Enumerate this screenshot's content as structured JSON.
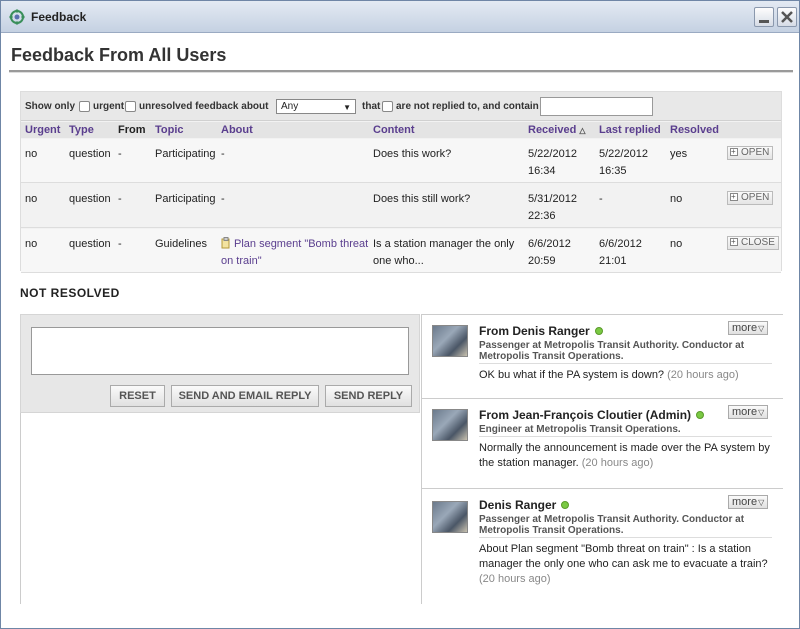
{
  "window": {
    "title": "Feedback"
  },
  "page": {
    "heading": "Feedback From All Users"
  },
  "filter": {
    "show_only": "Show only",
    "urgent": "urgent",
    "unresolved": "unresolved feedback about",
    "select_value": "Any",
    "that": "that",
    "not_replied": "are not replied to, and contain",
    "contain_value": ""
  },
  "table": {
    "headers": {
      "urgent": "Urgent",
      "type": "Type",
      "from": "From",
      "topic": "Topic",
      "about": "About",
      "content": "Content",
      "received": "Received",
      "last_replied": "Last replied",
      "resolved": "Resolved"
    },
    "rows": [
      {
        "urgent": "no",
        "type": "question",
        "from": "-",
        "topic": "Participating",
        "about": "-",
        "content": "Does this work?",
        "received_date": "5/22/2012",
        "received_time": "16:34",
        "replied_date": "5/22/2012",
        "replied_time": "16:35",
        "resolved": "yes",
        "action": "OPEN"
      },
      {
        "urgent": "no",
        "type": "question",
        "from": "-",
        "topic": "Participating",
        "about": "-",
        "content": "Does this still work?",
        "received_date": "5/31/2012",
        "received_time": "22:36",
        "replied_date": "-",
        "replied_time": "",
        "resolved": "no",
        "action": "OPEN"
      },
      {
        "urgent": "no",
        "type": "question",
        "from": "-",
        "topic": "Guidelines",
        "about_line1": "Plan segment \"Bomb threat",
        "about_line2": "on train\"",
        "content_line1": "Is a station manager the only",
        "content_line2": "one who...",
        "received_date": "6/6/2012",
        "received_time": "20:59",
        "replied_date": "6/6/2012",
        "replied_time": "21:01",
        "resolved": "no",
        "action": "CLOSE"
      }
    ]
  },
  "section": {
    "title": "NOT RESOLVED"
  },
  "reply": {
    "text": "",
    "reset_label": "RESET",
    "send_email_label": "SEND AND EMAIL REPLY",
    "send_label": "SEND REPLY"
  },
  "messages": [
    {
      "from": "From Denis Ranger",
      "role_line1": "Passenger at Metropolis Transit Authority. Conductor at",
      "role_line2": "Metropolis Transit Operations.",
      "body": "OK bu what if the PA system is down?",
      "time": "(20 hours ago)",
      "more": "more"
    },
    {
      "from": "From Jean-François Cloutier (Admin)",
      "role_line1": "Engineer at Metropolis Transit Operations.",
      "body_line1": "Normally the announcement is made over the PA system by",
      "body_line2": "the station manager.",
      "time": "(20 hours ago)",
      "more": "more"
    },
    {
      "from": "Denis Ranger",
      "role_line1": "Passenger at Metropolis Transit Authority. Conductor at",
      "role_line2": "Metropolis Transit Operations.",
      "body_line1": "About Plan segment \"Bomb threat on train\" : Is a station",
      "body_line2": "manager the only one who can ask me to evacuate a train?",
      "time": "(20 hours ago)",
      "more": "more"
    }
  ],
  "colors": {
    "link": "#5a3e8e",
    "online": "#7ac943"
  }
}
